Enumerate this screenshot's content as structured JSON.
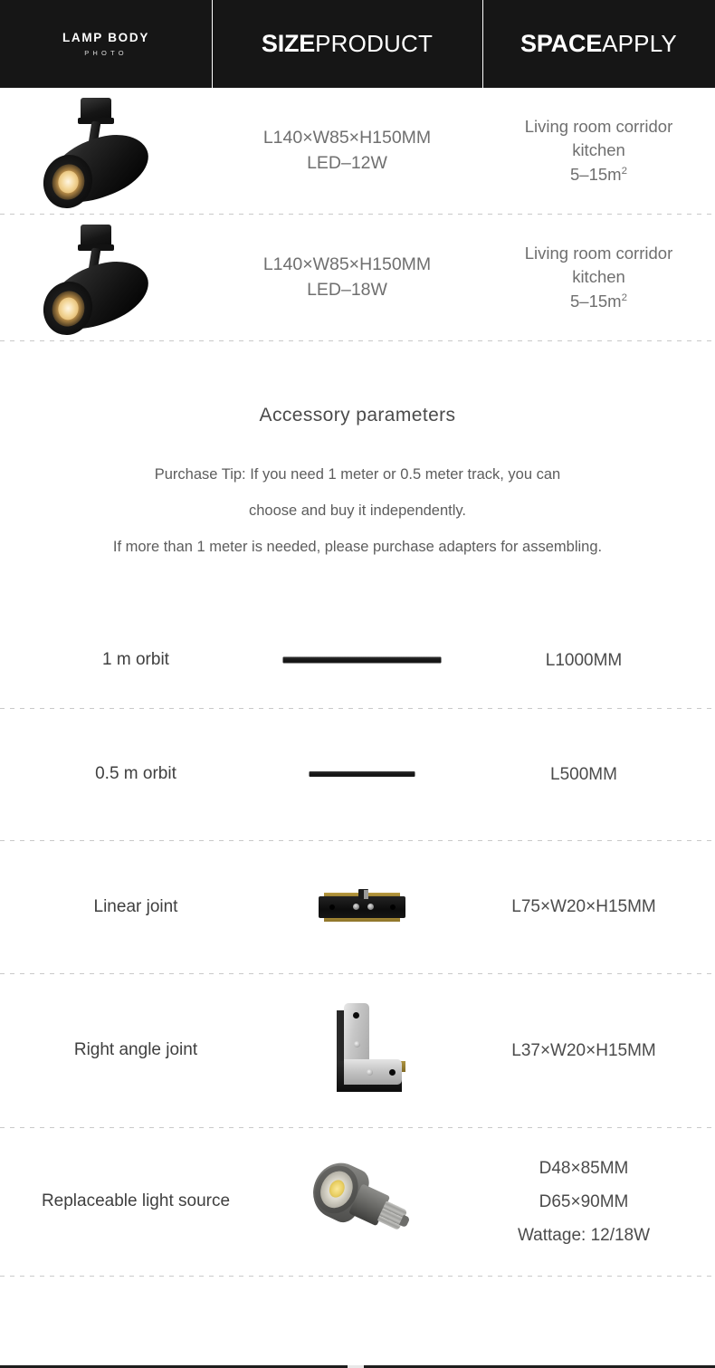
{
  "header": {
    "brand_line1": "LAMP BODY",
    "brand_line2": "PHOTO",
    "size_strong": "SIZE",
    "size_light": "PRODUCT",
    "space_strong": "SPACE",
    "space_light": "APPLY"
  },
  "products": [
    {
      "image": "track-spotlight-black",
      "size_line1": "L140×W85×H150MM",
      "size_line2": "LED–12W",
      "space_line1": "Living room corridor",
      "space_line2": "kitchen",
      "space_line3": "5–15m",
      "space_sup": "2"
    },
    {
      "image": "track-spotlight-black",
      "size_line1": "L140×W85×H150MM",
      "size_line2": "LED–18W",
      "space_line1": "Living room corridor",
      "space_line2": "kitchen",
      "space_line3": "5–15m",
      "space_sup": "2"
    }
  ],
  "accessory": {
    "title": "Accessory parameters",
    "tips": [
      "Purchase Tip: If you need 1 meter or 0.5 meter track, you can",
      "choose and buy it independently.",
      "If more than 1 meter is needed, please purchase adapters for assembling."
    ],
    "rows": [
      {
        "name": "1 m orbit",
        "image": "track-rail-1000",
        "spec_1": "L1000MM",
        "spec_2": "",
        "spec_3": ""
      },
      {
        "name": "0.5 m orbit",
        "image": "track-rail-500",
        "spec_1": "L500MM",
        "spec_2": "",
        "spec_3": ""
      },
      {
        "name": "Linear joint",
        "image": "linear-connector",
        "spec_1": "L75×W20×H15MM",
        "spec_2": "",
        "spec_3": ""
      },
      {
        "name": "Right angle joint",
        "image": "l-shape-connector",
        "spec_1": "L37×W20×H15MM",
        "spec_2": "",
        "spec_3": ""
      },
      {
        "name": "Replaceable light source",
        "image": "led-bulb-e27",
        "spec_1": "D48×85MM",
        "spec_2": "D65×90MM",
        "spec_3": "Wattage: 12/18W"
      }
    ]
  },
  "colors": {
    "header_bg": "#161616",
    "page_bg": "#ffffff",
    "divider": "#c9c9c9",
    "text_gray": "#5d5d5d",
    "brass": "#a98f3b",
    "led_warm": "#e9cf63"
  }
}
